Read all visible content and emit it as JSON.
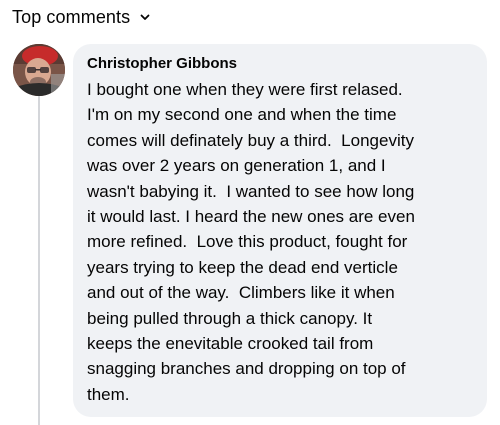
{
  "comments_header": {
    "label": "Top comments",
    "chevron_icon": "chevron-down-icon"
  },
  "comment": {
    "author": "Christopher Gibbons",
    "avatar_icon": "profile-photo",
    "text": "I bought one when they were first relased.\nI'm on my second one and when the time\ncomes will definately buy a third.  Longevity\nwas over 2 years on generation 1, and I\nwasn't babying it.  I wanted to see how long\nit would last. I heard the new ones are even\nmore refined.  Love this product, fought for\nyears trying to keep the dead end verticle\nand out of the way.  Climbers like it when\nbeing pulled through a thick canopy. It\nkeeps the enevitable crooked tail from\nsnagging branches and dropping on top of\nthem."
  },
  "colors": {
    "bubble_background": "#f0f2f5",
    "text": "#050505",
    "thread_line": "#d4d6da"
  }
}
